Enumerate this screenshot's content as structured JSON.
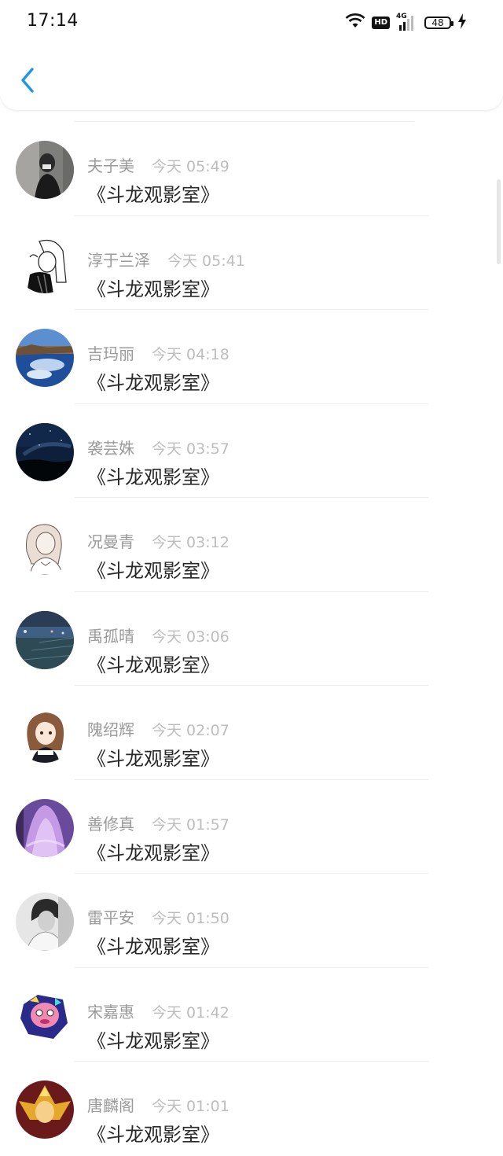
{
  "status_bar": {
    "time": "17:14",
    "hd": "HD",
    "network": "4G",
    "battery": "48"
  },
  "nav": {
    "back_icon": "chevron-left-icon",
    "accent": "#2196e8"
  },
  "messages": [
    {
      "name": "夫子美",
      "time": "今天 05:49",
      "text": "《斗龙观影室》"
    },
    {
      "name": "淳于兰泽",
      "time": "今天 05:41",
      "text": "《斗龙观影室》"
    },
    {
      "name": "吉玛丽",
      "time": "今天 04:18",
      "text": "《斗龙观影室》"
    },
    {
      "name": "袭芸姝",
      "time": "今天 03:57",
      "text": "《斗龙观影室》"
    },
    {
      "name": "况曼青",
      "time": "今天 03:12",
      "text": "《斗龙观影室》"
    },
    {
      "name": "禹孤晴",
      "time": "今天 03:06",
      "text": "《斗龙观影室》"
    },
    {
      "name": "隗绍辉",
      "time": "今天 02:07",
      "text": "《斗龙观影室》"
    },
    {
      "name": "善修真",
      "time": "今天 01:57",
      "text": "《斗龙观影室》"
    },
    {
      "name": "雷平安",
      "time": "今天 01:50",
      "text": "《斗龙观影室》"
    },
    {
      "name": "宋嘉惠",
      "time": "今天 01:42",
      "text": "《斗龙观影室》"
    },
    {
      "name": "唐麟阁",
      "time": "今天 01:01",
      "text": "《斗龙观影室》"
    }
  ]
}
